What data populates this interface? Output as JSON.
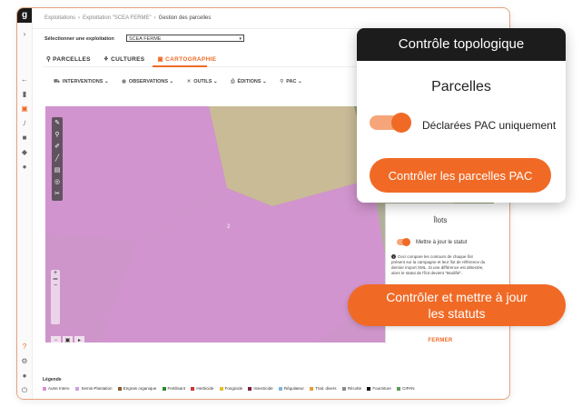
{
  "app": {
    "logo": "g",
    "breadcrumb": [
      "Exploitations",
      "Exploitation \"SCEA FERME\"",
      "Gestion des parcelles"
    ],
    "select_label": "Sélectionner une exploitation",
    "select_value": "SCEA FERME",
    "tabs": [
      {
        "label": "PARCELLES",
        "icon": "pin-icon"
      },
      {
        "label": "CULTURES",
        "icon": "sprout-icon"
      },
      {
        "label": "CARTOGRAPHIE",
        "icon": "map-icon"
      }
    ],
    "toolbar": [
      {
        "label": "INTERVENTIONS",
        "icon": "tractor-icon"
      },
      {
        "label": "OBSERVATIONS",
        "icon": "eye-icon"
      },
      {
        "label": "OUTILS",
        "icon": "tools-icon"
      },
      {
        "label": "ÉDITIONS",
        "icon": "printer-icon"
      },
      {
        "label": "PAC",
        "icon": "pac-icon"
      }
    ],
    "map_marker": "2",
    "ilots_panel": {
      "title": "Îlots",
      "toggle_label": "Mettre à jour le statut",
      "info": "Ceci compare les contours de chaque îlot présent sur la campagne et leur îlot de référence du dernier import XML. Si une différence est détectée, alors le statut de l'îlot devient \"Modifié\".",
      "close": "FERMER"
    },
    "legend_title": "Légende",
    "legend": [
      {
        "label": "Autre Interv.",
        "color": "#d98fd6"
      },
      {
        "label": "Semis-Plantation",
        "color": "#c8a0e0"
      },
      {
        "label": "Engrais organique",
        "color": "#8a5a2b"
      },
      {
        "label": "Fertilisant",
        "color": "#2a8a2a"
      },
      {
        "label": "Herbicide",
        "color": "#cc3333"
      },
      {
        "label": "Fongicide",
        "color": "#e0c020"
      },
      {
        "label": "Insecticide",
        "color": "#7a1f3d"
      },
      {
        "label": "Régulateur",
        "color": "#7fb3d9"
      },
      {
        "label": "Trait. divers",
        "color": "#e89b3a"
      },
      {
        "label": "Récolte",
        "color": "#8a8a8a"
      },
      {
        "label": "Fourniture",
        "color": "#111111"
      },
      {
        "label": "CIPAN",
        "color": "#5a9b5a"
      }
    ]
  },
  "popup": {
    "title": "Contrôle topologique",
    "subtitle": "Parcelles",
    "toggle_label": "Déclarées PAC uniquement",
    "button": "Contrôler les parcelles PAC"
  },
  "status_button": {
    "line1": "Contrôler et mettre à jour",
    "line2": "les statuts"
  },
  "colors": {
    "accent": "#f06a26",
    "parcel": "#d990d9"
  }
}
